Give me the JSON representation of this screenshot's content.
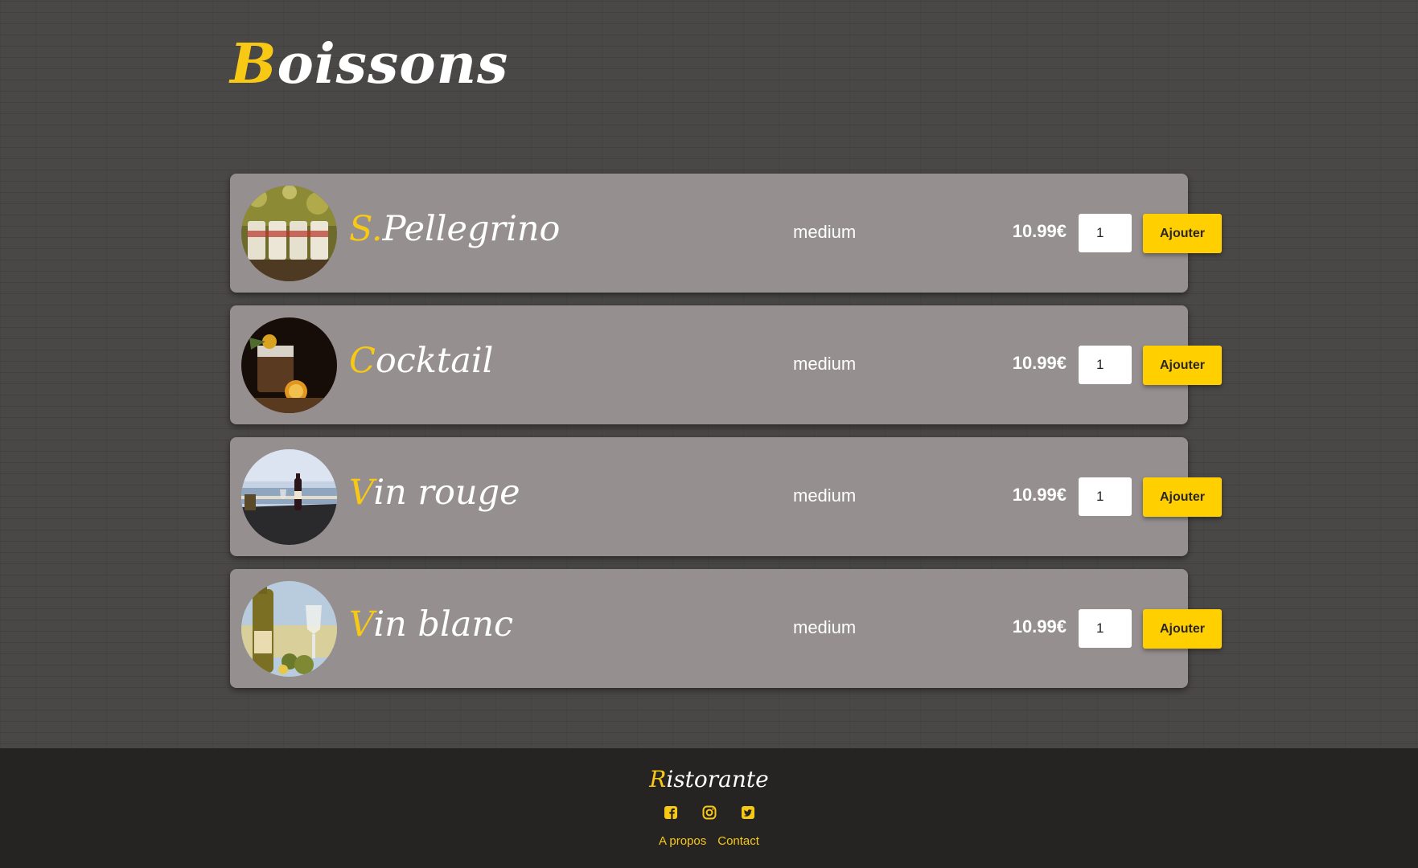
{
  "page": {
    "title_initial": "B",
    "title_rest": "oissons"
  },
  "items": [
    {
      "name_initial": "S.",
      "name_rest": "Pellegrino",
      "size": "medium",
      "price": "10.99€",
      "quantity": "1",
      "button": "Ajouter",
      "image": "pellegrino-bottles-photo"
    },
    {
      "name_initial": "C",
      "name_rest": "ocktail",
      "size": "medium",
      "price": "10.99€",
      "quantity": "1",
      "button": "Ajouter",
      "image": "cocktail-glass-photo"
    },
    {
      "name_initial": "V",
      "name_rest": "in rouge",
      "size": "medium",
      "price": "10.99€",
      "quantity": "1",
      "button": "Ajouter",
      "image": "red-wine-terrace-photo"
    },
    {
      "name_initial": "V",
      "name_rest": "in blanc",
      "size": "medium",
      "price": "10.99€",
      "quantity": "1",
      "button": "Ajouter",
      "image": "white-wine-bottle-photo"
    }
  ],
  "footer": {
    "brand_initial": "R",
    "brand_rest": "istorante",
    "social": [
      "facebook-icon",
      "instagram-icon",
      "twitter-icon"
    ],
    "links": [
      "A propos",
      "Contact"
    ]
  },
  "colors": {
    "accent": "#ffcf00",
    "initial": "#f7c914",
    "card": "#968f8f",
    "background": "#4a4747",
    "footer": "#262323"
  }
}
